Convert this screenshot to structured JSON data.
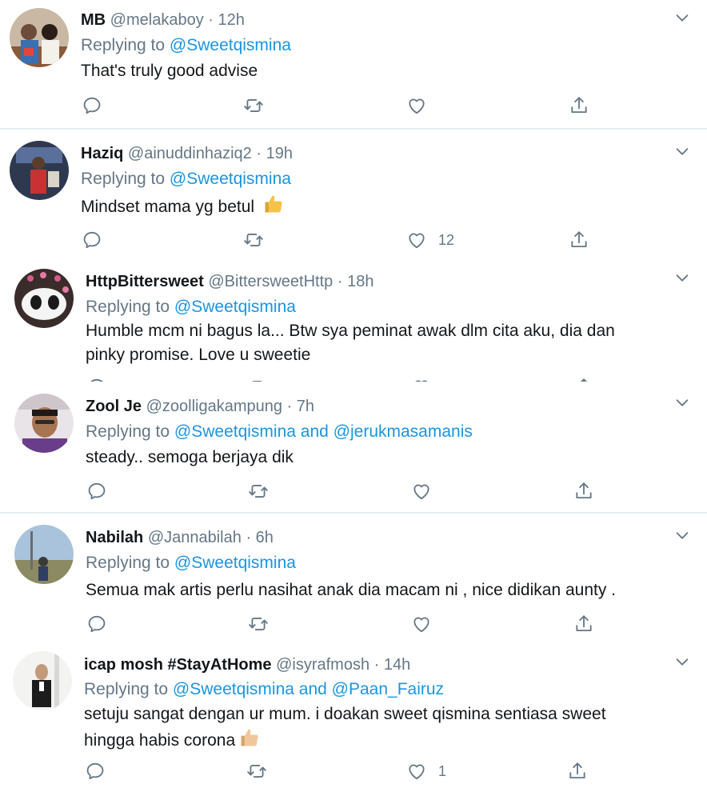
{
  "tweets": [
    {
      "name": "MB",
      "handle": "@melakaboy",
      "time": "12h",
      "replying_prefix": "Replying to ",
      "mentions": "@Sweetqismina",
      "text": "That's truly good advise",
      "like_count": ""
    },
    {
      "name": "Haziq",
      "handle": "@ainuddinhaziq2",
      "time": "19h",
      "replying_prefix": "Replying to ",
      "mentions": "@Sweetqismina",
      "text": "Mindset mama yg betul",
      "like_count": "12"
    },
    {
      "name": "HttpBittersweet",
      "handle": "@BittersweetHttp",
      "time": "18h",
      "replying_prefix": "Replying to ",
      "mentions": "@Sweetqismina",
      "text_line1": "Humble  mcm ni bagus la... Btw sya peminat awak dlm cita aku, dia dan",
      "text_line2": "pinky promise. Love u sweetie"
    },
    {
      "name": "Zool Je",
      "handle": "@zoolligakampung",
      "time": "7h",
      "replying_prefix": "Replying to ",
      "mentions": "@Sweetqismina and @jerukmasamanis",
      "text": "steady.. semoga berjaya dik",
      "like_count": ""
    },
    {
      "name": "Nabilah",
      "handle": "@Jannabilah",
      "time": "6h",
      "replying_prefix": "Replying to ",
      "mentions": "@Sweetqismina",
      "text": "Semua mak artis perlu nasihat anak dia macam ni , nice didikan aunty .",
      "like_count": ""
    },
    {
      "name": "icap mosh #StayAtHome",
      "handle": "@isyrafmosh",
      "time": "14h",
      "replying_prefix": "Replying to ",
      "mentions": "@Sweetqismina and @Paan_Fairuz",
      "text_line1": "setuju sangat dengan ur mum. i doakan sweet qismina sentiasa sweet",
      "text_line2": "hingga habis corona",
      "like_count": "1"
    }
  ],
  "dot": "·",
  "colors": {
    "accent": "#1b95e0",
    "secondary_text": "#657786",
    "divider": "#e6ecf0"
  },
  "icons": [
    "reply-icon",
    "retweet-icon",
    "like-icon",
    "share-icon",
    "chevron-down-icon",
    "thumbs-up-emoji"
  ]
}
